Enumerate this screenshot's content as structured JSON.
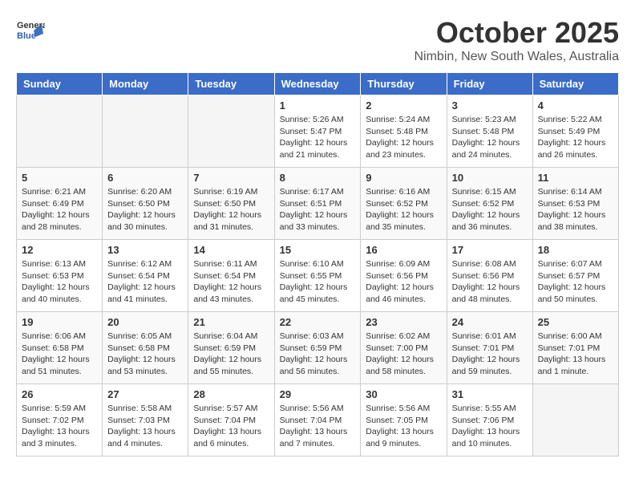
{
  "header": {
    "logo_general": "General",
    "logo_blue": "Blue",
    "title": "October 2025",
    "subtitle": "Nimbin, New South Wales, Australia"
  },
  "days_of_week": [
    "Sunday",
    "Monday",
    "Tuesday",
    "Wednesday",
    "Thursday",
    "Friday",
    "Saturday"
  ],
  "weeks": [
    {
      "days": [
        {
          "num": "",
          "info": ""
        },
        {
          "num": "",
          "info": ""
        },
        {
          "num": "",
          "info": ""
        },
        {
          "num": "1",
          "info": "Sunrise: 5:26 AM\nSunset: 5:47 PM\nDaylight: 12 hours\nand 21 minutes."
        },
        {
          "num": "2",
          "info": "Sunrise: 5:24 AM\nSunset: 5:48 PM\nDaylight: 12 hours\nand 23 minutes."
        },
        {
          "num": "3",
          "info": "Sunrise: 5:23 AM\nSunset: 5:48 PM\nDaylight: 12 hours\nand 24 minutes."
        },
        {
          "num": "4",
          "info": "Sunrise: 5:22 AM\nSunset: 5:49 PM\nDaylight: 12 hours\nand 26 minutes."
        }
      ]
    },
    {
      "days": [
        {
          "num": "5",
          "info": "Sunrise: 6:21 AM\nSunset: 6:49 PM\nDaylight: 12 hours\nand 28 minutes."
        },
        {
          "num": "6",
          "info": "Sunrise: 6:20 AM\nSunset: 6:50 PM\nDaylight: 12 hours\nand 30 minutes."
        },
        {
          "num": "7",
          "info": "Sunrise: 6:19 AM\nSunset: 6:50 PM\nDaylight: 12 hours\nand 31 minutes."
        },
        {
          "num": "8",
          "info": "Sunrise: 6:17 AM\nSunset: 6:51 PM\nDaylight: 12 hours\nand 33 minutes."
        },
        {
          "num": "9",
          "info": "Sunrise: 6:16 AM\nSunset: 6:52 PM\nDaylight: 12 hours\nand 35 minutes."
        },
        {
          "num": "10",
          "info": "Sunrise: 6:15 AM\nSunset: 6:52 PM\nDaylight: 12 hours\nand 36 minutes."
        },
        {
          "num": "11",
          "info": "Sunrise: 6:14 AM\nSunset: 6:53 PM\nDaylight: 12 hours\nand 38 minutes."
        }
      ]
    },
    {
      "days": [
        {
          "num": "12",
          "info": "Sunrise: 6:13 AM\nSunset: 6:53 PM\nDaylight: 12 hours\nand 40 minutes."
        },
        {
          "num": "13",
          "info": "Sunrise: 6:12 AM\nSunset: 6:54 PM\nDaylight: 12 hours\nand 41 minutes."
        },
        {
          "num": "14",
          "info": "Sunrise: 6:11 AM\nSunset: 6:54 PM\nDaylight: 12 hours\nand 43 minutes."
        },
        {
          "num": "15",
          "info": "Sunrise: 6:10 AM\nSunset: 6:55 PM\nDaylight: 12 hours\nand 45 minutes."
        },
        {
          "num": "16",
          "info": "Sunrise: 6:09 AM\nSunset: 6:56 PM\nDaylight: 12 hours\nand 46 minutes."
        },
        {
          "num": "17",
          "info": "Sunrise: 6:08 AM\nSunset: 6:56 PM\nDaylight: 12 hours\nand 48 minutes."
        },
        {
          "num": "18",
          "info": "Sunrise: 6:07 AM\nSunset: 6:57 PM\nDaylight: 12 hours\nand 50 minutes."
        }
      ]
    },
    {
      "days": [
        {
          "num": "19",
          "info": "Sunrise: 6:06 AM\nSunset: 6:58 PM\nDaylight: 12 hours\nand 51 minutes."
        },
        {
          "num": "20",
          "info": "Sunrise: 6:05 AM\nSunset: 6:58 PM\nDaylight: 12 hours\nand 53 minutes."
        },
        {
          "num": "21",
          "info": "Sunrise: 6:04 AM\nSunset: 6:59 PM\nDaylight: 12 hours\nand 55 minutes."
        },
        {
          "num": "22",
          "info": "Sunrise: 6:03 AM\nSunset: 6:59 PM\nDaylight: 12 hours\nand 56 minutes."
        },
        {
          "num": "23",
          "info": "Sunrise: 6:02 AM\nSunset: 7:00 PM\nDaylight: 12 hours\nand 58 minutes."
        },
        {
          "num": "24",
          "info": "Sunrise: 6:01 AM\nSunset: 7:01 PM\nDaylight: 12 hours\nand 59 minutes."
        },
        {
          "num": "25",
          "info": "Sunrise: 6:00 AM\nSunset: 7:01 PM\nDaylight: 13 hours\nand 1 minute."
        }
      ]
    },
    {
      "days": [
        {
          "num": "26",
          "info": "Sunrise: 5:59 AM\nSunset: 7:02 PM\nDaylight: 13 hours\nand 3 minutes."
        },
        {
          "num": "27",
          "info": "Sunrise: 5:58 AM\nSunset: 7:03 PM\nDaylight: 13 hours\nand 4 minutes."
        },
        {
          "num": "28",
          "info": "Sunrise: 5:57 AM\nSunset: 7:04 PM\nDaylight: 13 hours\nand 6 minutes."
        },
        {
          "num": "29",
          "info": "Sunrise: 5:56 AM\nSunset: 7:04 PM\nDaylight: 13 hours\nand 7 minutes."
        },
        {
          "num": "30",
          "info": "Sunrise: 5:56 AM\nSunset: 7:05 PM\nDaylight: 13 hours\nand 9 minutes."
        },
        {
          "num": "31",
          "info": "Sunrise: 5:55 AM\nSunset: 7:06 PM\nDaylight: 13 hours\nand 10 minutes."
        },
        {
          "num": "",
          "info": ""
        }
      ]
    }
  ]
}
